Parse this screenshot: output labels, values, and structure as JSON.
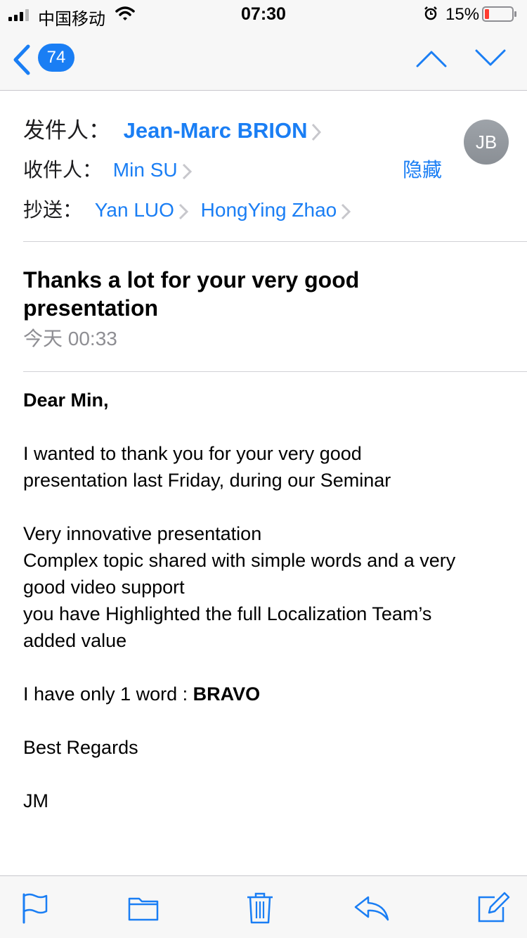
{
  "status": {
    "carrier": "中国移动",
    "time": "07:30",
    "battery_pct": "15%"
  },
  "nav": {
    "unread_count": "74"
  },
  "header": {
    "from_label": "发件人：",
    "from_name": "Jean-Marc BRION",
    "to_label": "收件人：",
    "to_name": "Min SU",
    "cc_label": "抄送：",
    "cc_names": [
      "Yan LUO",
      "HongYing Zhao"
    ],
    "hide_label": "隐藏",
    "avatar_initials": "JB"
  },
  "email": {
    "subject": "Thanks a lot for your very good presentation",
    "date": "今天 00:33",
    "greeting": "Dear Min,",
    "para1_line1": "I wanted to thank you for your very good",
    "para1_line2": "presentation last Friday, during our Seminar",
    "line_a": "Very innovative presentation",
    "line_b1": "Complex topic shared with simple words and a very",
    "line_b2": "good video support",
    "line_c1": "you have Highlighted the full Localization Team’s",
    "line_c2": "added value",
    "bravo_prefix": "I have only 1 word : ",
    "bravo_word": "BRAVO",
    "regards": "Best Regards",
    "signature": "JM"
  },
  "colors": {
    "accent": "#1a7ef4",
    "battery_low": "#ff3b30",
    "secondary_text": "#8e8e93"
  },
  "icons": {
    "toolbar": [
      "flag-icon",
      "folder-icon",
      "trash-icon",
      "reply-icon",
      "compose-icon"
    ]
  }
}
